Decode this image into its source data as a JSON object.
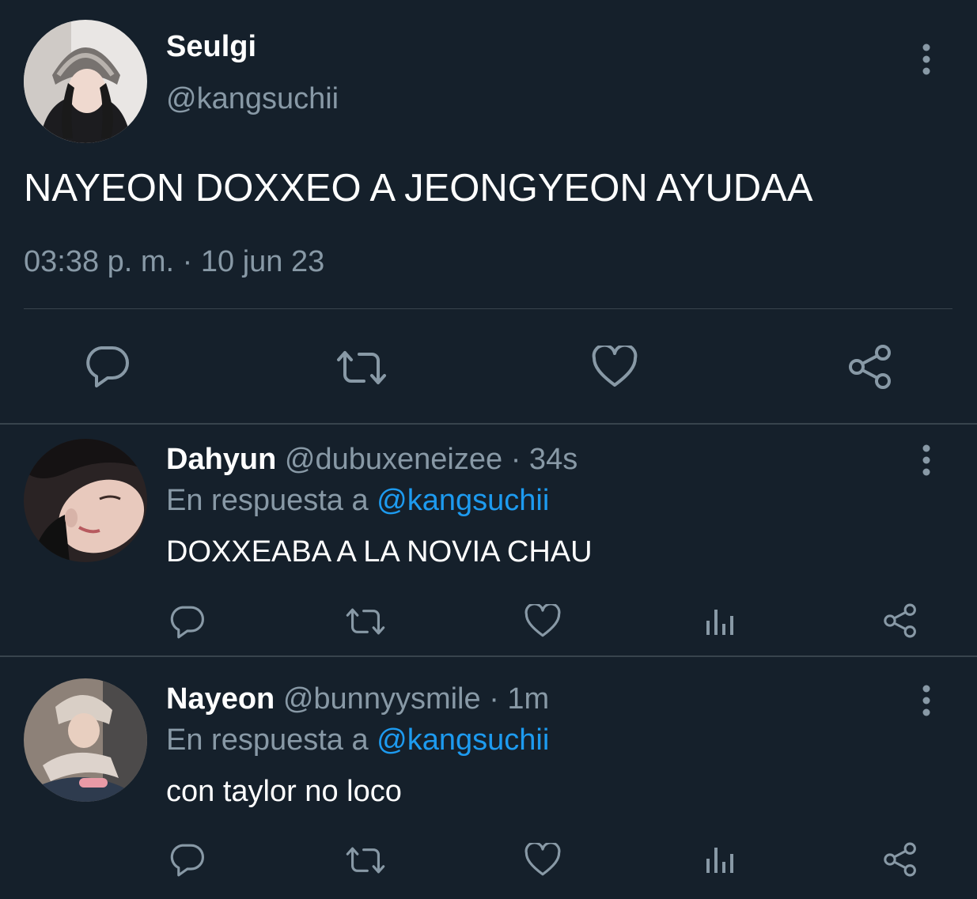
{
  "colors": {
    "background": "#15202b",
    "muted": "#8899a6",
    "link": "#1d9bf0",
    "divider": "#38444d"
  },
  "main_tweet": {
    "author_name": "Seulgi",
    "author_handle": "@kangsuchii",
    "text": "NAYEON DOXXEO A JEONGYEON AYUDAA",
    "timestamp": "03:38 p. m. · 10 jun 23",
    "actions": [
      "reply-icon",
      "retweet-icon",
      "like-icon",
      "share-icon"
    ]
  },
  "replies": [
    {
      "author_name": "Dahyun",
      "author_handle": "@dubuxeneizee",
      "time": "· 34s",
      "reply_prefix": "En respuesta a",
      "reply_to": "@kangsuchii",
      "text": "DOXXEABA A LA NOVIA CHAU",
      "actions": [
        "reply-icon",
        "retweet-icon",
        "like-icon",
        "analytics-icon",
        "share-icon"
      ]
    },
    {
      "author_name": "Nayeon",
      "author_handle": "@bunnyysmile",
      "time": "· 1m",
      "reply_prefix": "En respuesta a",
      "reply_to": "@kangsuchii",
      "text": "con taylor no loco",
      "actions": [
        "reply-icon",
        "retweet-icon",
        "like-icon",
        "analytics-icon",
        "share-icon"
      ]
    }
  ]
}
